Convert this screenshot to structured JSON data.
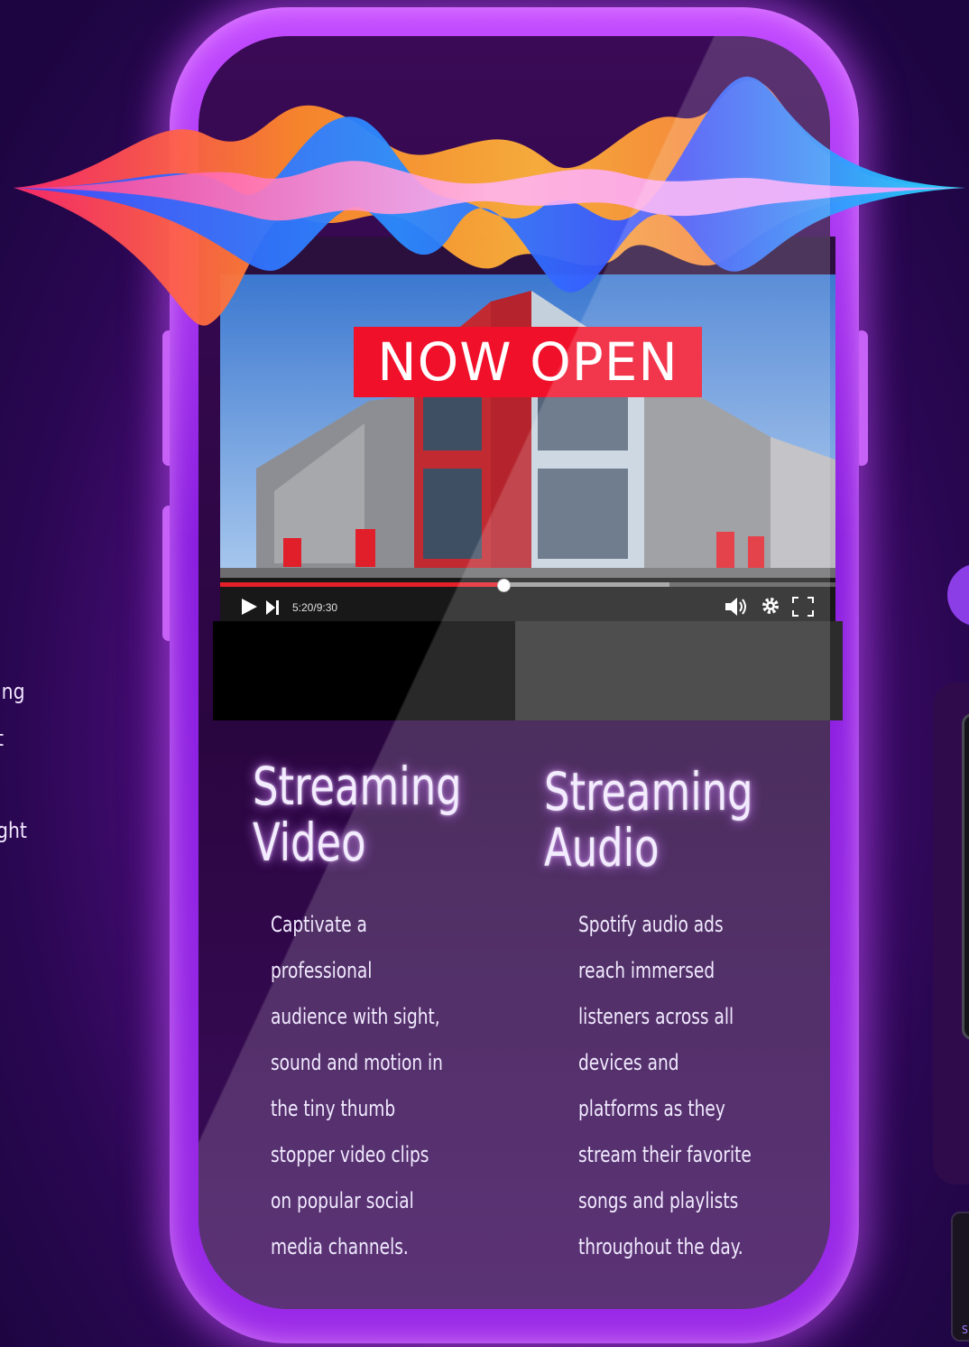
{
  "left_edge_text": [
    "ing",
    "t",
    "ght"
  ],
  "video": {
    "banner": "NOW OPEN",
    "time": "5:20/9:30",
    "progress": 0.46,
    "buffered": 0.73
  },
  "columns": [
    {
      "heading_line1": "Streaming",
      "heading_line2": "Video",
      "lines": [
        "Captivate a",
        "professional",
        "audience with sight,",
        "sound and motion in",
        "the tiny thumb",
        "stopper video clips",
        "on popular social",
        "media channels."
      ]
    },
    {
      "heading_line1": "Streaming",
      "heading_line2": "Audio",
      "lines": [
        "Spotify audio ads",
        "reach immersed",
        "listeners across all",
        "devices and",
        "platforms as they",
        "stream their favorite",
        "songs and playlists",
        "throughout the day."
      ]
    }
  ],
  "right_edge_text": "S"
}
